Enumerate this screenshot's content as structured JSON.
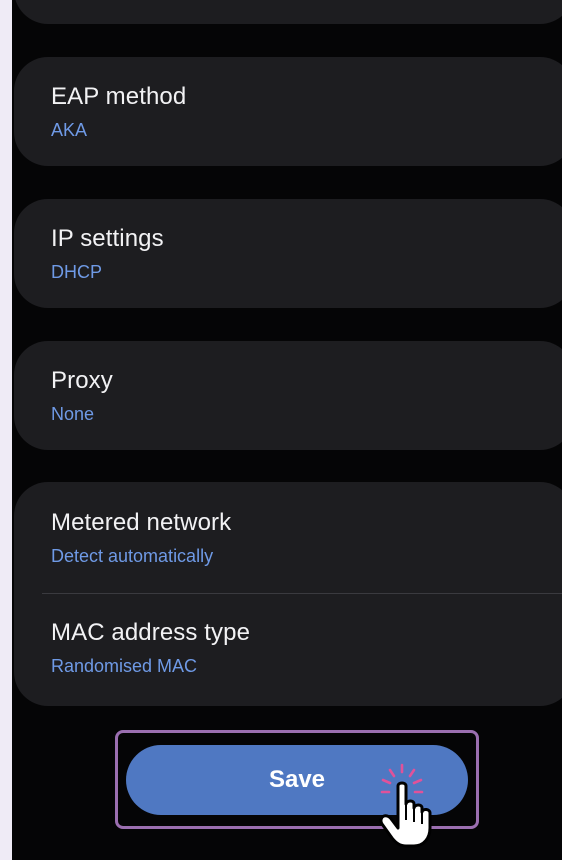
{
  "settings": {
    "eap_method": {
      "title": "EAP method",
      "value": "AKA"
    },
    "ip_settings": {
      "title": "IP settings",
      "value": "DHCP"
    },
    "proxy": {
      "title": "Proxy",
      "value": "None"
    },
    "metered_network": {
      "title": "Metered network",
      "value": "Detect automatically"
    },
    "mac_address_type": {
      "title": "MAC address type",
      "value": "Randomised MAC"
    }
  },
  "actions": {
    "save_label": "Save"
  },
  "colors": {
    "background": "#050506",
    "card": "#1d1d20",
    "value_text": "#6f9ae6",
    "save_button": "#4f78c2",
    "highlight_frame": "#9b6fb0",
    "tap_burst": "#e0529a"
  },
  "icons": {
    "cursor": "hand-pointer-icon"
  }
}
